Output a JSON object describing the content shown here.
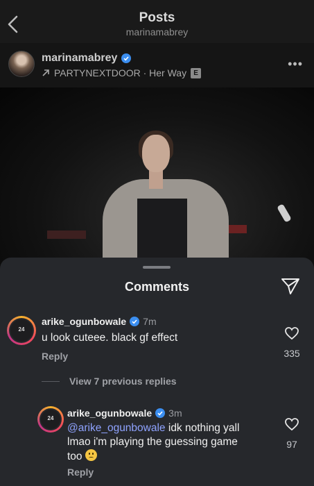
{
  "header": {
    "title": "Posts",
    "subtitle": "marinamabrey"
  },
  "post": {
    "username": "marinamabrey",
    "music": "PARTYNEXTDOOR · Her Way",
    "explicit_badge": "E"
  },
  "comments_sheet": {
    "title": "Comments",
    "comment": {
      "username": "arike_ogunbowale",
      "time": "7m",
      "text": "u look cuteee. black gf effect",
      "reply_label": "Reply",
      "likes": "335",
      "avatar_text": "24"
    },
    "view_replies": "View 7 previous replies",
    "reply": {
      "username": "arike_ogunbowale",
      "time": "3m",
      "mention": "@arike_ogunbowale",
      "text_line1": " idk nothing yall",
      "text_line2": "lmao i'm playing the guessing game",
      "text_line3": "too",
      "reply_label": "Reply",
      "likes": "97",
      "avatar_text": "24"
    }
  },
  "colors": {
    "verified": "#3b8ef0",
    "mention": "#8fa3ff",
    "sheet_bg": "#26282c"
  },
  "icons": {
    "back": "chevron-left-icon",
    "more": "more-horizontal-icon",
    "send": "send-icon",
    "heart": "heart-icon",
    "verified": "verified-badge-icon",
    "music": "arrow-up-right-icon",
    "emoji": "confused-face-icon"
  }
}
